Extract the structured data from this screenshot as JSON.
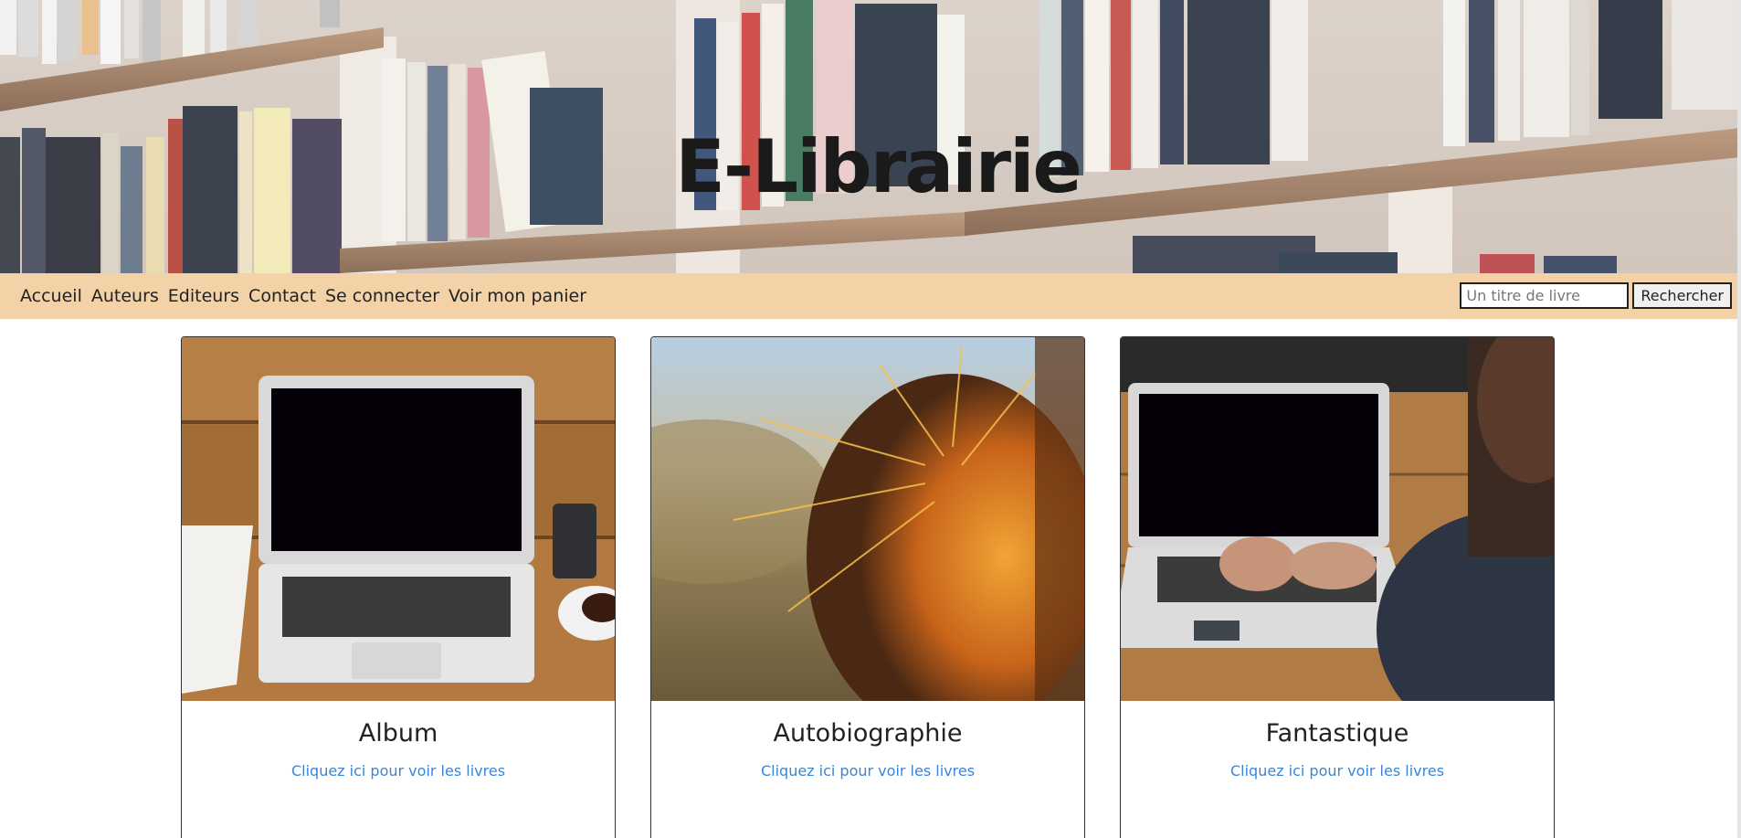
{
  "banner": {
    "title": "E-Librairie"
  },
  "nav": {
    "links": [
      {
        "label": "Accueil"
      },
      {
        "label": "Auteurs"
      },
      {
        "label": "Editeurs"
      },
      {
        "label": "Contact"
      },
      {
        "label": "Se connecter"
      },
      {
        "label": "Voir mon panier"
      }
    ]
  },
  "search": {
    "placeholder": "Un titre de livre",
    "value": "",
    "button_label": "Rechercher"
  },
  "categories": [
    {
      "title": "Album",
      "link": "Cliquez ici pour voir les livres",
      "image": "laptop-on-desk"
    },
    {
      "title": "Autobiographie",
      "link": "Cliquez ici pour voir les livres",
      "image": "cactus-closeup"
    },
    {
      "title": "Fantastique",
      "link": "Cliquez ici pour voir les livres",
      "image": "person-typing-laptop"
    }
  ],
  "colors": {
    "nav_background": "#f2d2a6",
    "link": "#3a86d4",
    "title": "#1a1a1a"
  }
}
